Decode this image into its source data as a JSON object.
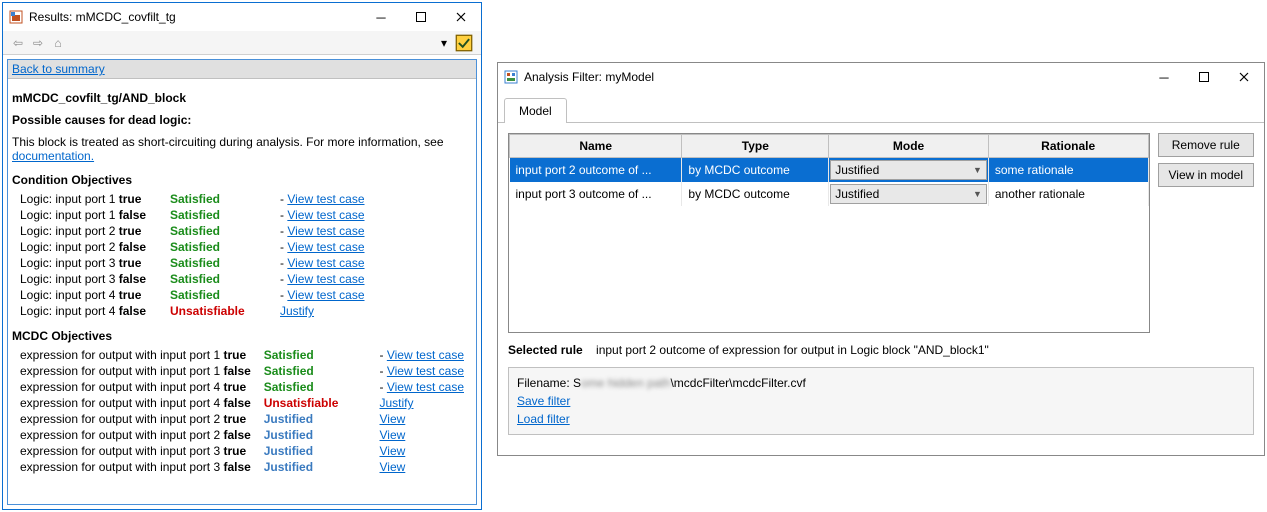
{
  "results_window": {
    "title": "Results: mMCDC_covfilt_tg",
    "back_link": "Back to summary",
    "block_path": "mMCDC_covfilt_tg/AND_block",
    "causes_header": "Possible causes for dead logic:",
    "causes_text": "This block is treated as short-circuiting during analysis. For more information, see ",
    "causes_doc_link": "documentation.",
    "cond_header": "Condition Objectives",
    "mcdc_header": "MCDC Objectives",
    "condition_rows": [
      {
        "label_pre": "Logic: input port 1 ",
        "label_bold": "true",
        "status": "Satisfied",
        "status_class": "green",
        "action_dash": "- ",
        "action": "View test case"
      },
      {
        "label_pre": "Logic: input port 1 ",
        "label_bold": "false",
        "status": "Satisfied",
        "status_class": "green",
        "action_dash": "- ",
        "action": "View test case"
      },
      {
        "label_pre": "Logic: input port 2 ",
        "label_bold": "true",
        "status": "Satisfied",
        "status_class": "green",
        "action_dash": "- ",
        "action": "View test case"
      },
      {
        "label_pre": "Logic: input port 2 ",
        "label_bold": "false",
        "status": "Satisfied",
        "status_class": "green",
        "action_dash": "- ",
        "action": "View test case"
      },
      {
        "label_pre": "Logic: input port 3 ",
        "label_bold": "true",
        "status": "Satisfied",
        "status_class": "green",
        "action_dash": "- ",
        "action": "View test case"
      },
      {
        "label_pre": "Logic: input port 3 ",
        "label_bold": "false",
        "status": "Satisfied",
        "status_class": "green",
        "action_dash": "- ",
        "action": "View test case"
      },
      {
        "label_pre": "Logic: input port 4 ",
        "label_bold": "true",
        "status": "Satisfied",
        "status_class": "green",
        "action_dash": "- ",
        "action": "View test case"
      },
      {
        "label_pre": "Logic: input port 4 ",
        "label_bold": "false",
        "status": "Unsatisfiable",
        "status_class": "red",
        "action_dash": "",
        "action": "Justify"
      }
    ],
    "mcdc_rows": [
      {
        "label_pre": "expression for output with input port 1 ",
        "label_bold": "true",
        "status": "Satisfied",
        "status_class": "green",
        "action_dash": "- ",
        "action": "View test case"
      },
      {
        "label_pre": "expression for output with input port 1 ",
        "label_bold": "false",
        "status": "Satisfied",
        "status_class": "green",
        "action_dash": "- ",
        "action": "View test case"
      },
      {
        "label_pre": "expression for output with input port 4 ",
        "label_bold": "true",
        "status": "Satisfied",
        "status_class": "green",
        "action_dash": "- ",
        "action": "View test case"
      },
      {
        "label_pre": "expression for output with input port 4 ",
        "label_bold": "false",
        "status": "Unsatisfiable",
        "status_class": "red",
        "action_dash": "",
        "action": "Justify"
      },
      {
        "label_pre": "expression for output with input port 2 ",
        "label_bold": "true",
        "status": "Justified",
        "status_class": "blue-status",
        "action_dash": "",
        "action": "View"
      },
      {
        "label_pre": "expression for output with input port 2 ",
        "label_bold": "false",
        "status": "Justified",
        "status_class": "blue-status",
        "action_dash": "",
        "action": "View"
      },
      {
        "label_pre": "expression for output with input port 3 ",
        "label_bold": "true",
        "status": "Justified",
        "status_class": "blue-status",
        "action_dash": "",
        "action": "View"
      },
      {
        "label_pre": "expression for output with input port 3 ",
        "label_bold": "false",
        "status": "Justified",
        "status_class": "blue-status",
        "action_dash": "",
        "action": "View"
      }
    ]
  },
  "filter_window": {
    "title": "Analysis Filter: myModel",
    "tab_label": "Model",
    "columns": {
      "name": "Name",
      "type": "Type",
      "mode": "Mode",
      "rationale": "Rationale"
    },
    "rows": [
      {
        "selected": true,
        "name": "input port 2 outcome of ...",
        "type": "by MCDC outcome",
        "mode": "Justified",
        "rationale": "some rationale"
      },
      {
        "selected": false,
        "name": "input port 3 outcome of ...",
        "type": "by MCDC outcome",
        "mode": "Justified",
        "rationale": "another rationale"
      }
    ],
    "remove_btn": "Remove rule",
    "view_btn": "View in model",
    "selected_label": "Selected rule",
    "selected_text": "input port 2 outcome of expression for output in Logic block \"AND_block1\"",
    "filename_label": "Filename: S",
    "filename_blur": "ome hidden path",
    "filename_tail": "\\mcdcFilter\\mcdcFilter.cvf",
    "save_link": "Save filter",
    "load_link": "Load filter"
  }
}
